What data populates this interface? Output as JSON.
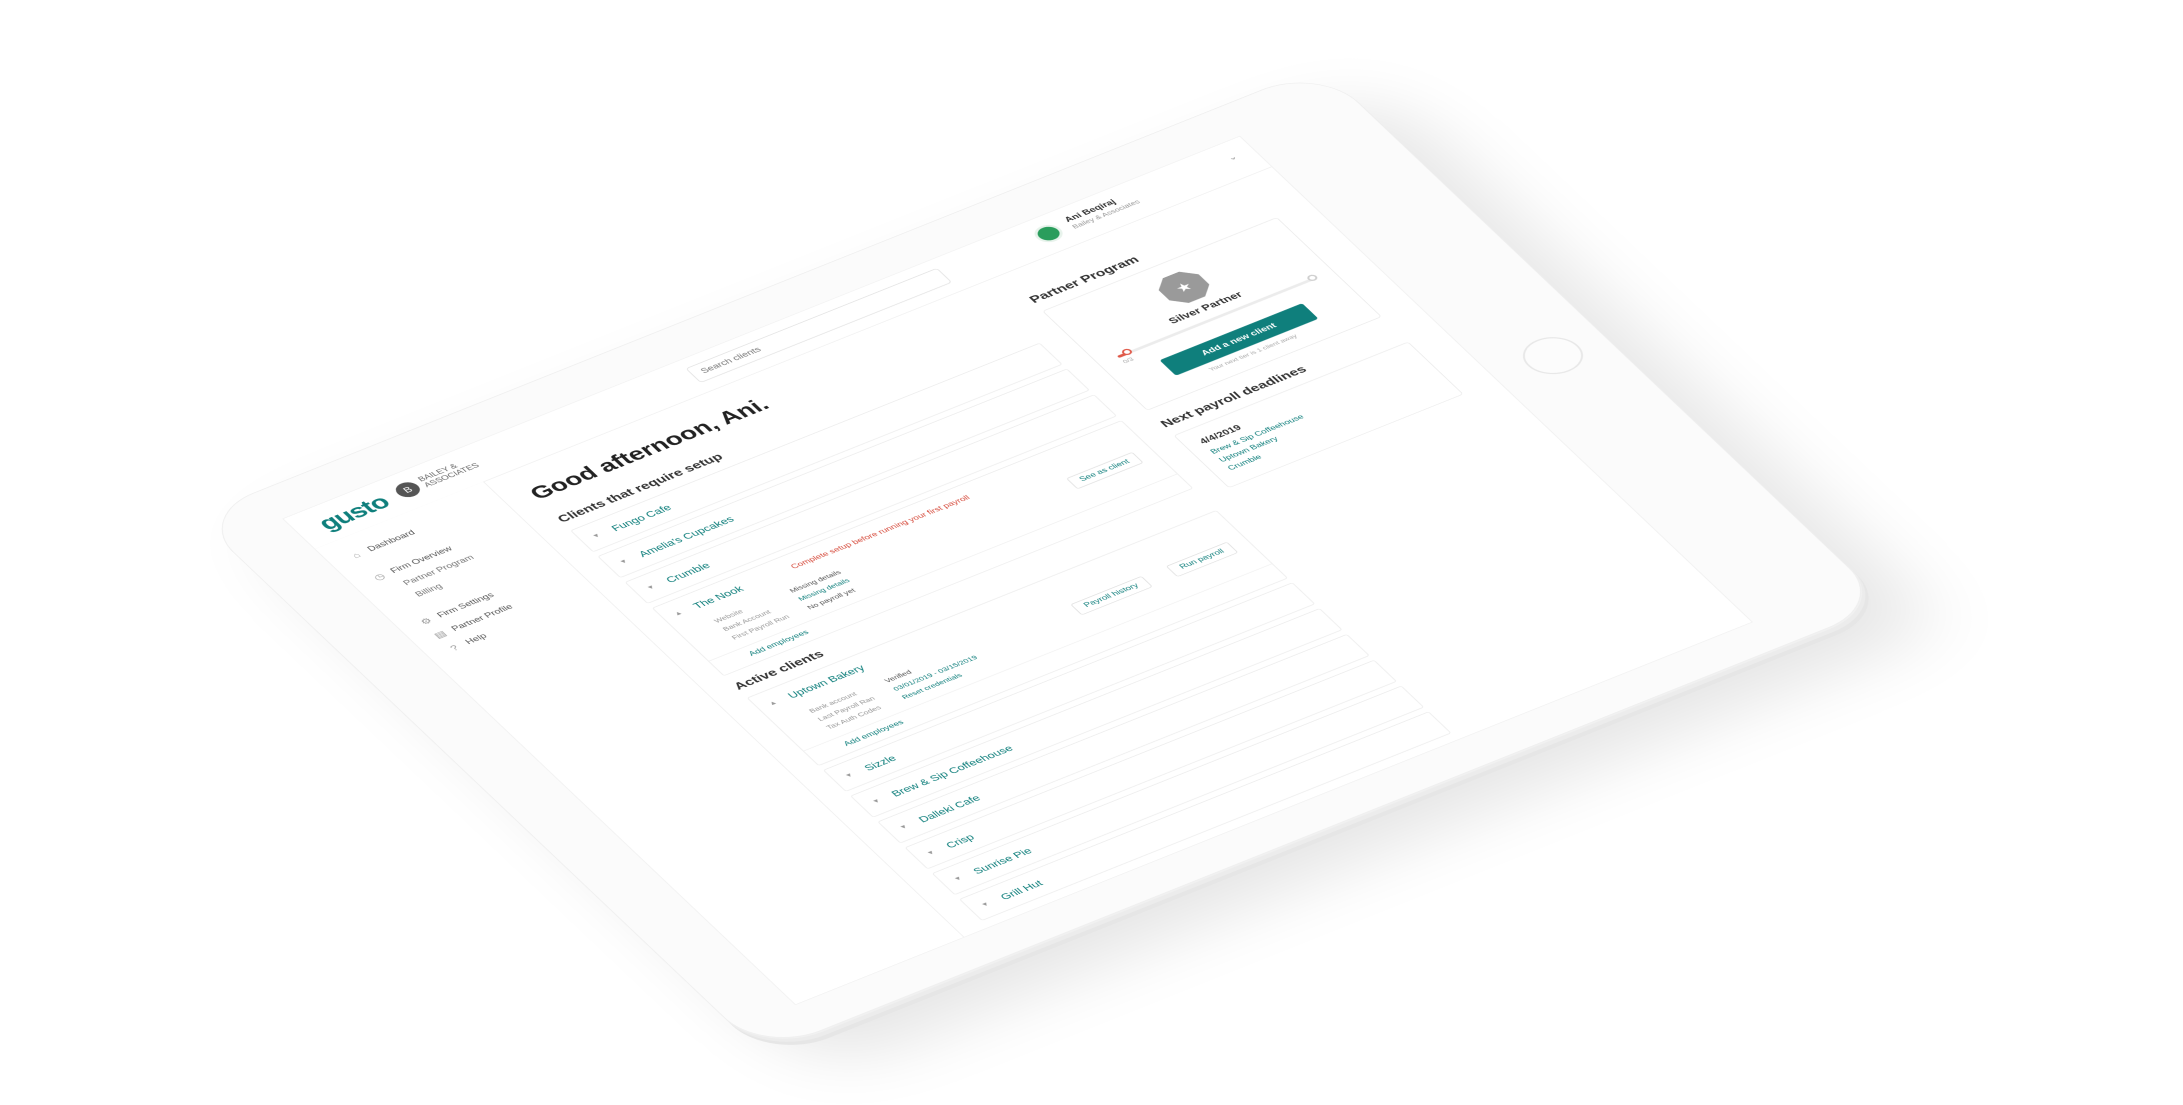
{
  "app": {
    "logo": "gusto",
    "firm_initial": "B",
    "firm_name": "BAILEY &\nASSOCIATES",
    "search_placeholder": "Search clients"
  },
  "user": {
    "name": "Ani Beqiraj",
    "firm": "Bailey & Associates",
    "chevron": "⌄"
  },
  "sidebar": {
    "items": [
      {
        "label": "Dashboard",
        "icon": "home-icon",
        "glyph": "⌂",
        "sub": false
      },
      {
        "label": "Firm Overview",
        "icon": "clock-icon",
        "glyph": "◷",
        "sub": false
      },
      {
        "label": "Partner Program",
        "icon": "none",
        "glyph": "",
        "sub": true
      },
      {
        "label": "Billing",
        "icon": "none",
        "glyph": "",
        "sub": true
      },
      {
        "label": "Firm Settings",
        "icon": "gear-icon",
        "glyph": "⚙",
        "sub": false
      },
      {
        "label": "Partner Profile",
        "icon": "profile-icon",
        "glyph": "▤",
        "sub": false
      },
      {
        "label": "Help",
        "icon": "help-icon",
        "glyph": "?",
        "sub": false
      }
    ]
  },
  "main": {
    "greeting": "Good afternoon, Ani.",
    "setup_title": "Clients that require setup",
    "setup_clients": [
      {
        "name": "Fungo Cafe"
      },
      {
        "name": "Amelia's Cupcakes"
      },
      {
        "name": "Crumble"
      }
    ],
    "expanded_setup_client": {
      "name": "The Nook",
      "warning": "Complete setup before running your first payroll",
      "details": [
        {
          "label": "Website",
          "value": "Missing details",
          "link": false
        },
        {
          "label": "Bank Account",
          "value": "Missing details",
          "link": true
        },
        {
          "label": "First Payroll Run",
          "value": "No payroll yet",
          "link": false
        }
      ],
      "action": "See as client",
      "footer_links": [
        "Add employees"
      ]
    },
    "active_title": "Active clients",
    "expanded_active_client": {
      "name": "Uptown Bakery",
      "details": [
        {
          "label": "Bank account",
          "value": "Verified",
          "link": false
        },
        {
          "label": "Last Payroll Ran",
          "value": "03/01/2019 - 03/15/2019",
          "link": true
        },
        {
          "label": "Tax Auth Codes",
          "value": "Reset credentials",
          "link": true
        }
      ],
      "actions": [
        "Payroll history",
        "Run payroll"
      ],
      "footer_links": [
        "Add employees"
      ]
    },
    "active_clients": [
      {
        "name": "Sizzle"
      },
      {
        "name": "Brew & Sip Coffeehouse"
      },
      {
        "name": "Dalleki Cafe"
      },
      {
        "name": "Crisp"
      },
      {
        "name": "Sunrise Pie"
      },
      {
        "name": "Grill Hut"
      }
    ]
  },
  "partner_program": {
    "title": "Partner Program",
    "badge_glyph": "★",
    "level": "Silver Partner",
    "progress_fraction": 0.05,
    "progress_caption": "0/3",
    "button": "Add a new client",
    "button_caption": "Your next tier is 1 client away"
  },
  "deadlines": {
    "title": "Next payroll deadlines",
    "date": "4/4/2019",
    "clients": [
      "Brew & Sip Coffeehouse",
      "Uptown Bakery",
      "Crumble"
    ]
  },
  "colors": {
    "brand": "#0f7f7c",
    "warning": "#d64a3b"
  }
}
